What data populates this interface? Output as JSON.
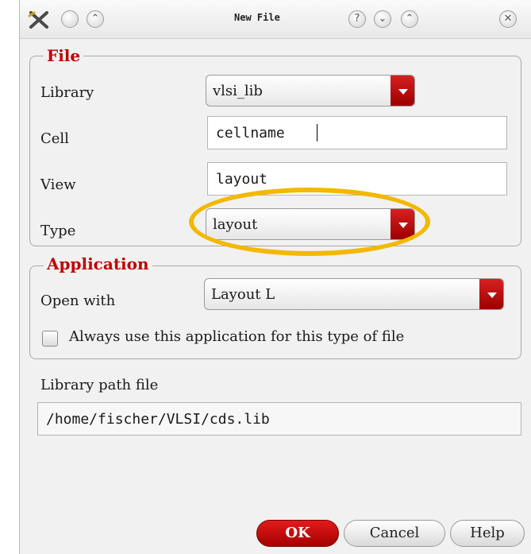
{
  "window": {
    "title": "New File"
  },
  "titlebar": {
    "buttons": [
      {
        "name": "minimize-dot-button"
      },
      {
        "name": "shade-button",
        "glyph": "⌃"
      },
      {
        "name": "help-button",
        "glyph": "?"
      },
      {
        "name": "minimize-button",
        "glyph": "⌄"
      },
      {
        "name": "maximize-button",
        "glyph": "⌃"
      },
      {
        "name": "close-button",
        "glyph": "✕"
      }
    ]
  },
  "file_group": {
    "legend": "File",
    "library_label": "Library",
    "library_value": "vlsi_lib",
    "cell_label": "Cell",
    "cell_value": "cellname",
    "view_label": "View",
    "view_value": "layout",
    "type_label": "Type",
    "type_value": "layout"
  },
  "application_group": {
    "legend": "Application",
    "open_with_label": "Open with",
    "open_with_value": "Layout L",
    "always_use_label": "Always use this application for this type of file",
    "always_use_checked": false
  },
  "library_path": {
    "label": "Library path file",
    "value": "/home/fischer/VLSI/cds.lib"
  },
  "buttons": {
    "ok": "OK",
    "cancel": "Cancel",
    "help": "Help"
  },
  "colors": {
    "accent_red": "#c00000",
    "highlight": "#f3b800"
  }
}
